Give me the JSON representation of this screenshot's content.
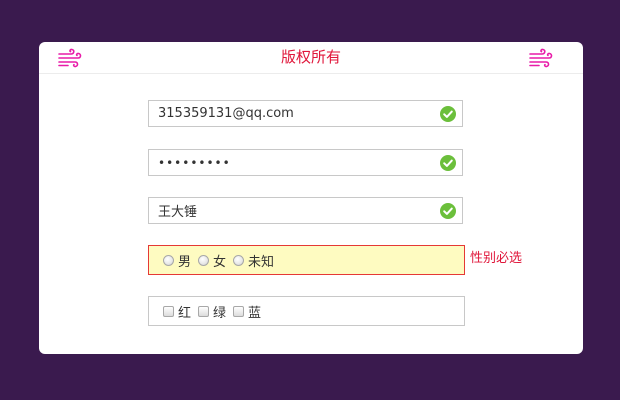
{
  "header": {
    "title": "版权所有",
    "accent_color": "#e0163a",
    "icon_color": "#e81ca8",
    "icons": [
      "wind-icon",
      "wind-icon"
    ]
  },
  "form": {
    "email": {
      "value": "315359131@qq.com",
      "status_icon": "check-circle-icon"
    },
    "password": {
      "value": "•••••••••",
      "status_icon": "check-circle-icon"
    },
    "name": {
      "value": "王大锤",
      "status_icon": "check-circle-icon"
    },
    "gender": {
      "options": [
        "男",
        "女",
        "未知"
      ],
      "error": "性别必选"
    },
    "colors": {
      "options": [
        "红",
        "绿",
        "蓝"
      ]
    },
    "valid_color": "#6bbf3b",
    "error_bg": "#fefbc1"
  }
}
